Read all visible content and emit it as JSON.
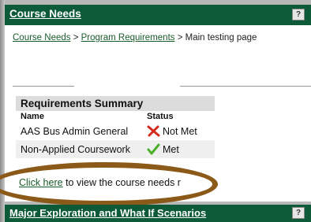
{
  "course_needs_panel": {
    "title": "Course Needs",
    "help_label": "?",
    "breadcrumb": {
      "items": [
        "Course Needs",
        "Program Requirements"
      ],
      "separator": ">",
      "current": "Main testing page"
    },
    "summary": {
      "title": "Requirements Summary",
      "columns": [
        "Name",
        "Status"
      ],
      "rows": [
        {
          "name": "AAS Bus Admin General",
          "status": "Not Met",
          "status_icon": "x-mark-icon"
        },
        {
          "name": "Non-Applied Coursework",
          "status": "Met",
          "status_icon": "check-mark-icon"
        }
      ]
    },
    "view_link": {
      "link_text": "Click here",
      "rest_text": "to view the course needs r"
    }
  },
  "major_panel": {
    "title": "Major Exploration and What If Scenarios",
    "help_label": "?"
  },
  "colors": {
    "header_bg": "#0c5a37",
    "link": "#1a5c2a",
    "highlight_ring": "#8c5a18",
    "not_met": "#d42a1e",
    "met": "#4caf2a"
  }
}
